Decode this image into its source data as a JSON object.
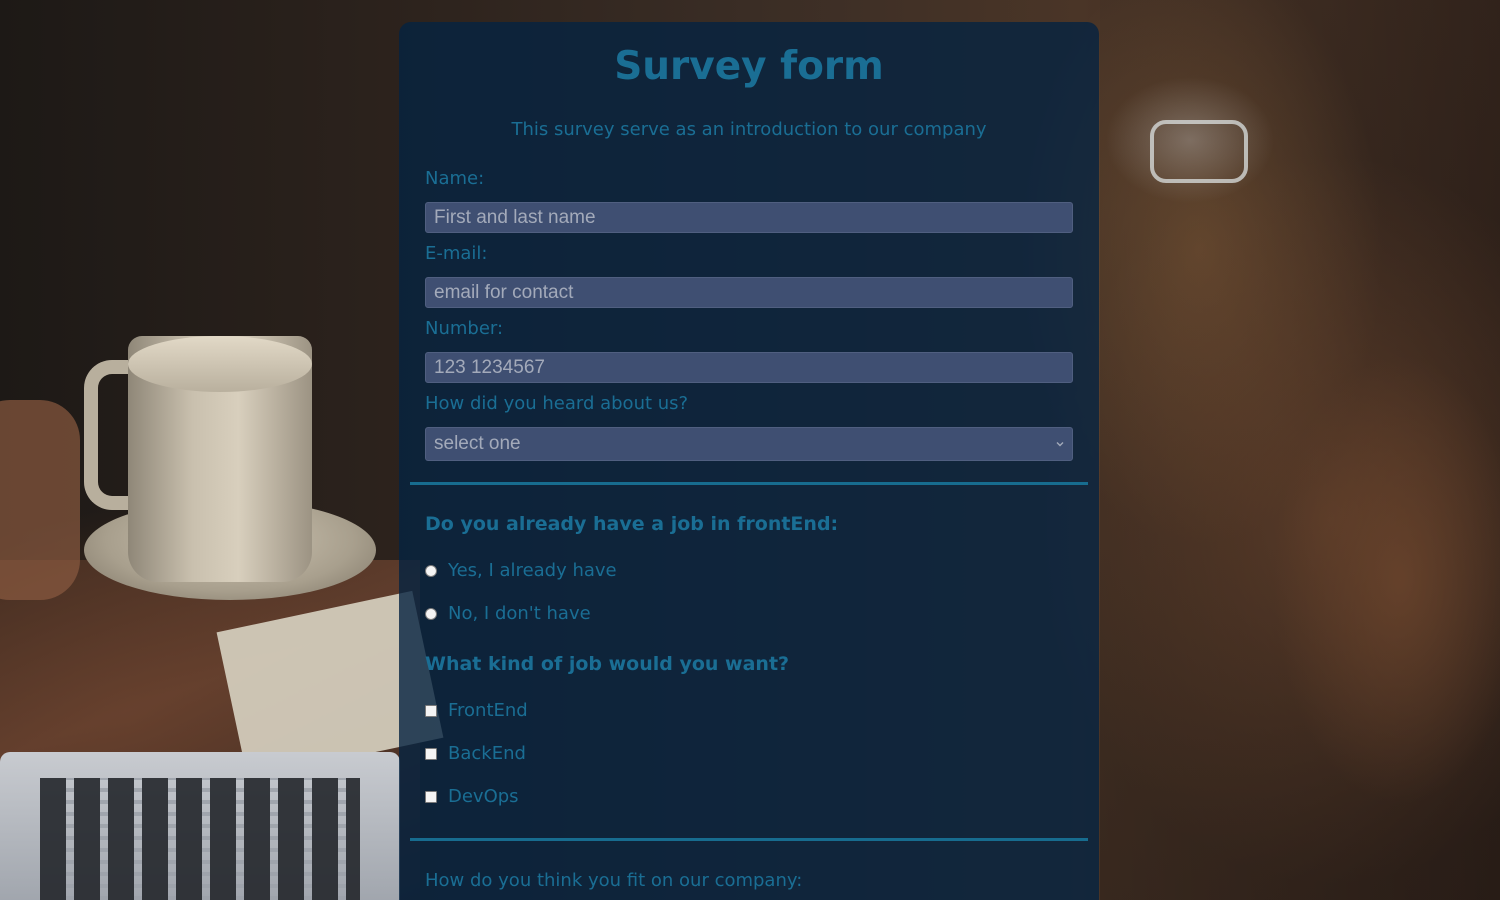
{
  "form": {
    "title": "Survey form",
    "description": "This survey serve as an introduction to our company",
    "name": {
      "label": "Name:",
      "placeholder": "First and last name",
      "value": ""
    },
    "email": {
      "label": "E-mail:",
      "placeholder": "email for contact",
      "value": ""
    },
    "number": {
      "label": "Number:",
      "placeholder": "123 1234567",
      "value": ""
    },
    "referral": {
      "label": "How did you heard about us?",
      "selected": "select one"
    },
    "job_status": {
      "question": "Do you already have a job in frontEnd:",
      "options": [
        {
          "label": "Yes, I already have",
          "checked": false
        },
        {
          "label": "No, I don't have",
          "checked": false
        }
      ]
    },
    "job_kind": {
      "question": "What kind of job would you want?",
      "options": [
        {
          "label": "FrontEnd",
          "checked": false
        },
        {
          "label": "BackEnd",
          "checked": false
        },
        {
          "label": "DevOps",
          "checked": false
        }
      ]
    },
    "fit": {
      "label": "How do you think you fit on our company:"
    }
  },
  "colors": {
    "accent": "#1a6e94",
    "panel_bg": "#052341",
    "field_bg": "#3f4f72",
    "placeholder": "#a3aaba",
    "divider": "#176c8f"
  },
  "icons": {
    "select_arrow": "chevron-down-icon"
  }
}
